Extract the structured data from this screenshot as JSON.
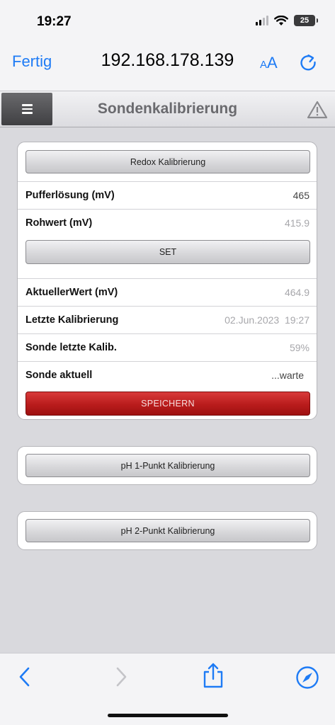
{
  "status_bar": {
    "time": "19:27",
    "battery": "25"
  },
  "browser": {
    "done_label": "Fertig",
    "url": "192.168.178.139",
    "text_size_label_small": "A",
    "text_size_label_large": "A"
  },
  "page": {
    "title": "Sondenkalibrierung"
  },
  "redox": {
    "header_button": "Redox Kalibrierung",
    "rows": [
      {
        "label": "Pufferlösung (mV)",
        "value": "465"
      },
      {
        "label": "Rohwert (mV)",
        "value": "415.9"
      }
    ],
    "set_button": "SET",
    "rows_after": [
      {
        "label": "AktuellerWert (mV)",
        "value": "464.9"
      },
      {
        "label": "Letzte Kalibrierung",
        "value": "02.Jun.2023  19:27"
      },
      {
        "label": "Sonde letzte Kalib.",
        "value": "59%"
      },
      {
        "label": "Sonde aktuell",
        "value": "...warte"
      }
    ],
    "save_button": "SPEICHERN"
  },
  "ph1": {
    "button": "pH 1-Punkt Kalibrierung"
  },
  "ph2": {
    "button": "pH 2-Punkt Kalibrierung"
  },
  "colors": {
    "accent": "#1e7bf5",
    "save_red": "#b91c1c"
  },
  "icons": [
    "signal-icon",
    "wifi-icon",
    "battery-icon",
    "reload-icon",
    "menu-icon",
    "warning-icon",
    "back-icon",
    "forward-icon",
    "share-icon",
    "compass-icon"
  ]
}
